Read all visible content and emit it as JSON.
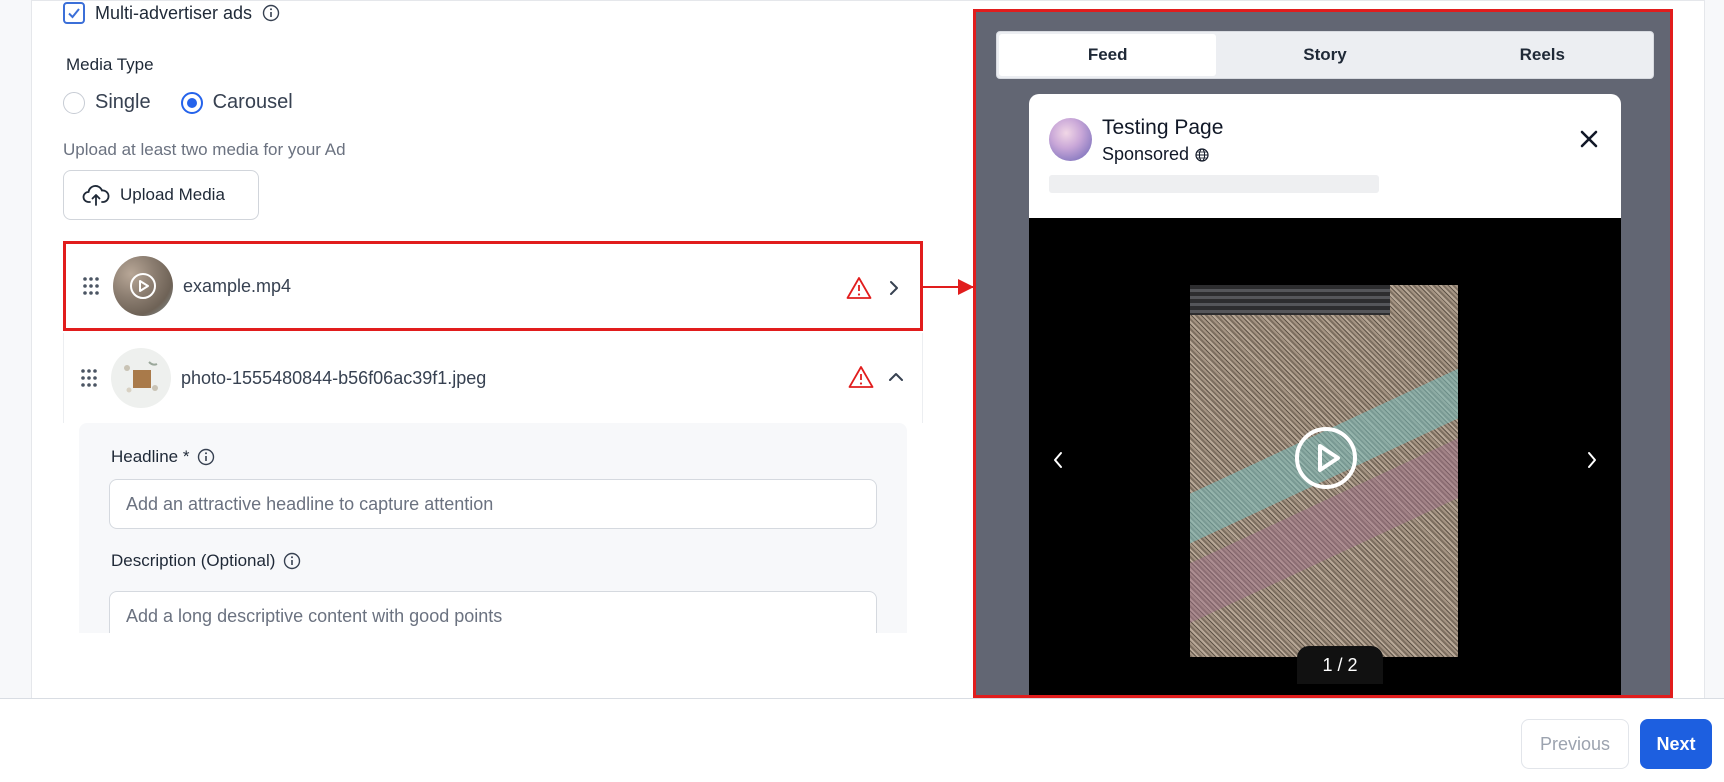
{
  "form": {
    "multi_advertiser_label": "Multi-advertiser ads",
    "media_type_label": "Media Type",
    "media_type_options": [
      "Single",
      "Carousel"
    ],
    "media_type_selected": "Carousel",
    "upload_hint": "Upload at least two media for your Ad",
    "upload_button": "Upload Media",
    "media_items": [
      {
        "file_name": "example.mp4",
        "kind": "video",
        "status_icon": "warning-icon",
        "toggle_icon": "chevron-right-icon"
      },
      {
        "file_name": "photo-1555480844-b56f06ac39f1.jpeg",
        "kind": "image",
        "status_icon": "warning-icon",
        "toggle_icon": "chevron-up-icon"
      }
    ],
    "headline_label": "Headline *",
    "headline_placeholder": "Add an attractive headline to capture attention",
    "description_label": "Description (Optional)",
    "description_placeholder": "Add a long descriptive content with good points"
  },
  "preview": {
    "tabs": [
      "Feed",
      "Story",
      "Reels"
    ],
    "active_tab": "Feed",
    "page_name": "Testing Page",
    "sponsored_label": "Sponsored",
    "counter": "1 / 2"
  },
  "footer": {
    "previous_label": "Previous",
    "next_label": "Next"
  },
  "colors": {
    "accent": "#2563eb",
    "next_button": "#1d5fe0",
    "highlight_border": "#e11d1d",
    "warning": "#e11d1d",
    "preview_backdrop": "#626673"
  }
}
